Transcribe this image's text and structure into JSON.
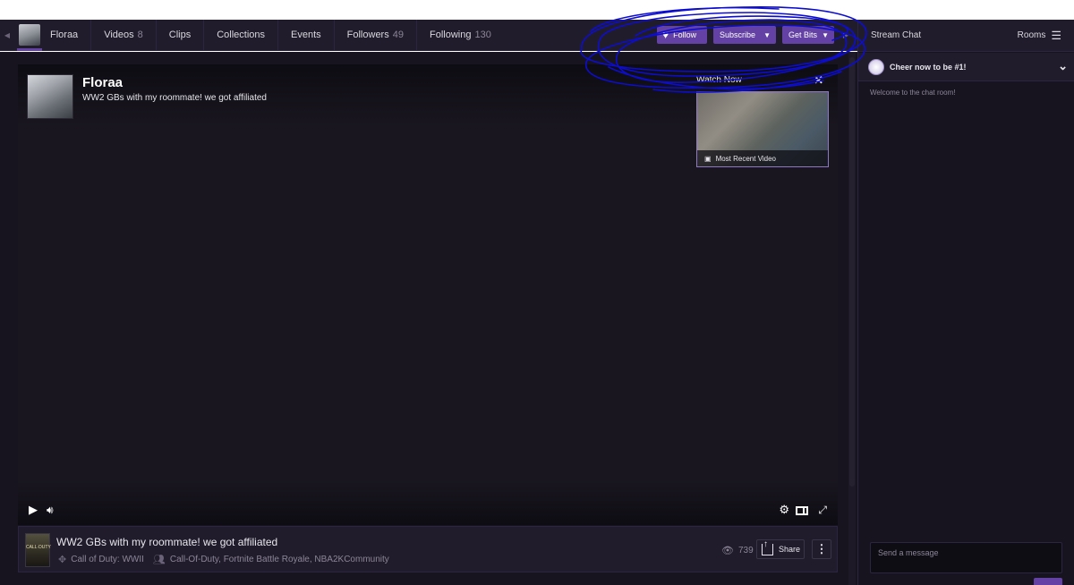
{
  "nav": {
    "channel_name": "Floraa",
    "items": [
      {
        "label": "Videos",
        "count": "8"
      },
      {
        "label": "Clips",
        "count": ""
      },
      {
        "label": "Collections",
        "count": ""
      },
      {
        "label": "Events",
        "count": ""
      },
      {
        "label": "Followers",
        "count": "49"
      },
      {
        "label": "Following",
        "count": "130"
      }
    ],
    "follow_label": "Follow",
    "subscribe_label": "Subscribe",
    "bits_label": "Get Bits"
  },
  "player": {
    "streamer": "Floraa",
    "title": "WW2 GBs with my roommate! we got affiliated",
    "watch_now_label": "Watch Now",
    "recent_video_label": "Most Recent Video"
  },
  "info": {
    "title": "WW2 GBs with my roommate! we got affiliated",
    "game": "Call of Duty: WWII",
    "communities": "Call-Of-Duty, Fortnite Battle Royale, NBA2KCommunity",
    "views": "739",
    "share_label": "Share",
    "game_art_text": "CALL·DUTY"
  },
  "chat": {
    "header": "Stream Chat",
    "rooms_label": "Rooms",
    "cheer_text": "Cheer now to be #1!",
    "welcome": "Welcome to the chat room!",
    "input_placeholder": "Send a message"
  },
  "colors": {
    "accent": "#6441a4",
    "background": "#17141f",
    "annotation": "#0d0dcf"
  }
}
